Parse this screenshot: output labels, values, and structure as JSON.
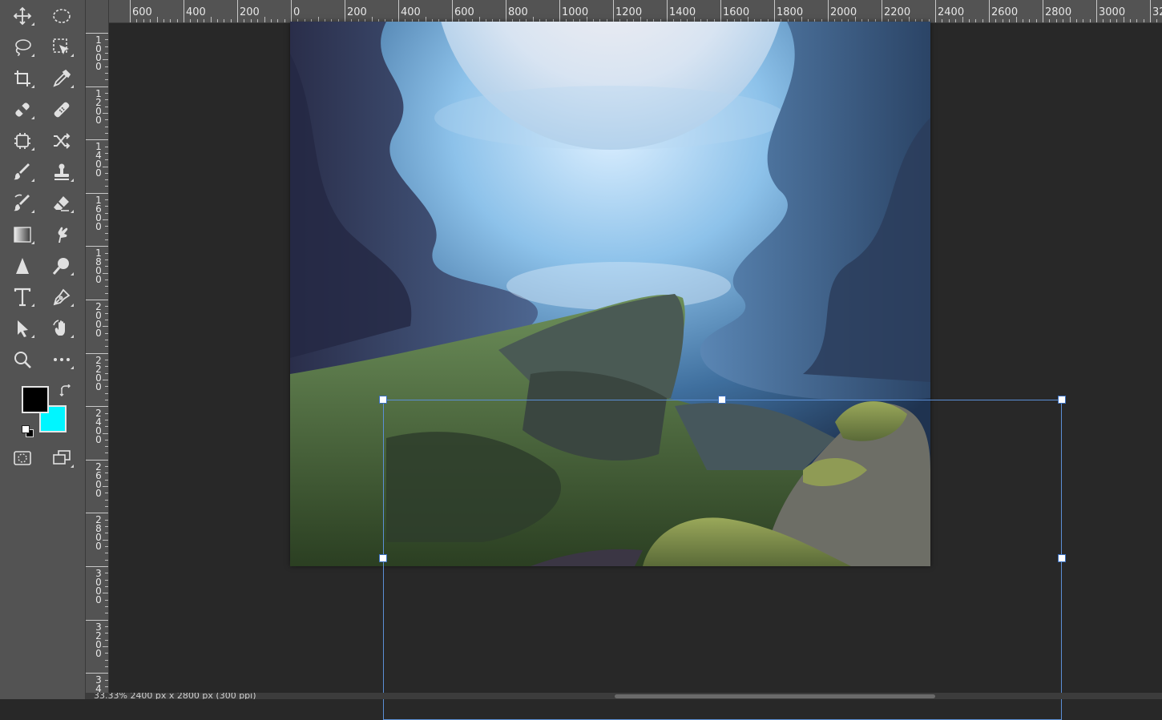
{
  "toolbar": {
    "tools": [
      {
        "name": "move-tool",
        "icon": "move-icon"
      },
      {
        "name": "marquee-tool",
        "icon": "elliptical-marquee-icon"
      },
      {
        "name": "lasso-tool",
        "icon": "lasso-icon"
      },
      {
        "name": "object-selection-tool",
        "icon": "object-selection-icon"
      },
      {
        "name": "crop-tool",
        "icon": "crop-icon"
      },
      {
        "name": "eyedropper-tool",
        "icon": "eyedropper-icon"
      },
      {
        "name": "spot-healing-tool",
        "icon": "spot-healing-brush-icon"
      },
      {
        "name": "healing-brush-tool",
        "icon": "bandage-icon"
      },
      {
        "name": "content-aware-tool",
        "icon": "chip-icon"
      },
      {
        "name": "content-aware-move-tool",
        "icon": "shuffle-icon"
      },
      {
        "name": "brush-tool",
        "icon": "brush-icon"
      },
      {
        "name": "clone-stamp-tool",
        "icon": "stamp-icon"
      },
      {
        "name": "history-brush-tool",
        "icon": "history-brush-icon"
      },
      {
        "name": "eraser-tool",
        "icon": "eraser-icon"
      },
      {
        "name": "gradient-tool",
        "icon": "gradient-icon"
      },
      {
        "name": "smudge-tool",
        "icon": "smudge-icon"
      },
      {
        "name": "sharpen-tool",
        "icon": "triangle-icon"
      },
      {
        "name": "dodge-tool",
        "icon": "dodge-icon"
      },
      {
        "name": "type-tool",
        "icon": "type-icon"
      },
      {
        "name": "pen-tool",
        "icon": "pen-icon"
      },
      {
        "name": "path-selection-tool",
        "icon": "arrow-pointer-icon"
      },
      {
        "name": "hand-tool",
        "icon": "hand-rotate-icon"
      },
      {
        "name": "zoom-tool",
        "icon": "magnifier-icon"
      },
      {
        "name": "more-tools",
        "icon": "ellipsis-icon"
      }
    ],
    "foreground_color": "#000000",
    "background_color": "#00f6ff"
  },
  "ruler": {
    "top_labels": [
      "600",
      "400",
      "200",
      "0",
      "200",
      "400",
      "600",
      "800",
      "1000",
      "1200",
      "1400",
      "1600",
      "1800",
      "2000",
      "2200",
      "2400",
      "2600",
      "2800",
      "3000",
      "32"
    ],
    "left_labels": [
      "1000",
      "1200",
      "1400",
      "1600",
      "1800",
      "2000",
      "2200",
      "2400",
      "2600",
      "2800",
      "3000",
      "3200",
      "34"
    ]
  },
  "status": {
    "text": "33.33%    2400 px x 2800 px (300 ppi)"
  },
  "colors": {
    "app_bg": "#282828",
    "panel": "#535353",
    "transform_box": "#5b8fd6"
  }
}
